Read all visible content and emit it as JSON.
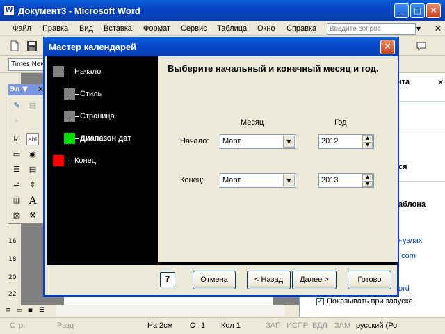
{
  "window": {
    "title": "Документ3 - Microsoft Word",
    "app_icon": "W",
    "minimize_glyph": "_",
    "maximize_glyph": "□",
    "close_glyph": "✕"
  },
  "menu": {
    "items": [
      "Файл",
      "Правка",
      "Вид",
      "Вставка",
      "Формат",
      "Сервис",
      "Таблица",
      "Окно",
      "Справка"
    ],
    "help_placeholder": "Введите вопрос",
    "close_glyph": "✕"
  },
  "formatting": {
    "font_name": "Times New"
  },
  "forms_toolbar": {
    "title": "Эл",
    "close_glyph": "✕"
  },
  "ruler": {
    "numbers": [
      "16",
      "18",
      "20",
      "22"
    ]
  },
  "task_pane": {
    "header_fragment": "нта",
    "frag_1": "ся",
    "frag_2": "аблона",
    "link_1": "б-узлах",
    "link_2": "t.com",
    "link_3": "ord",
    "show_at_startup": "Показывать при запуске"
  },
  "dialog": {
    "title": "Мастер календарей",
    "close_glyph": "✕",
    "steps": [
      {
        "label": "Начало",
        "color": "#808080",
        "current": false
      },
      {
        "label": "Стиль",
        "color": "#808080",
        "current": false
      },
      {
        "label": "Страница",
        "color": "#808080",
        "current": false
      },
      {
        "label": "Диапазон дат",
        "color": "#00e000",
        "current": true
      },
      {
        "label": "Конец",
        "color": "#ff0000",
        "current": false
      }
    ],
    "heading": "Выберите начальный и конечный месяц и год.",
    "col_month": "Месяц",
    "col_year": "Год",
    "start_label": "Начало:",
    "end_label": "Конец:",
    "start_month": "Март",
    "start_year": "2012",
    "end_month": "Март",
    "end_year": "2013",
    "help_glyph": "?",
    "cancel": "Отмена",
    "back": "< Назад",
    "next": "Далее >",
    "finish": "Готово"
  },
  "status": {
    "page": "Стр.",
    "section": "Разд",
    "at": "На  2см",
    "line": "Ст  1",
    "col": "Кол  1",
    "rec": "ЗАП",
    "trk": "ИСПР",
    "ext": "ВДЛ",
    "ovr": "ЗАМ",
    "lang": "русский (Ро"
  }
}
